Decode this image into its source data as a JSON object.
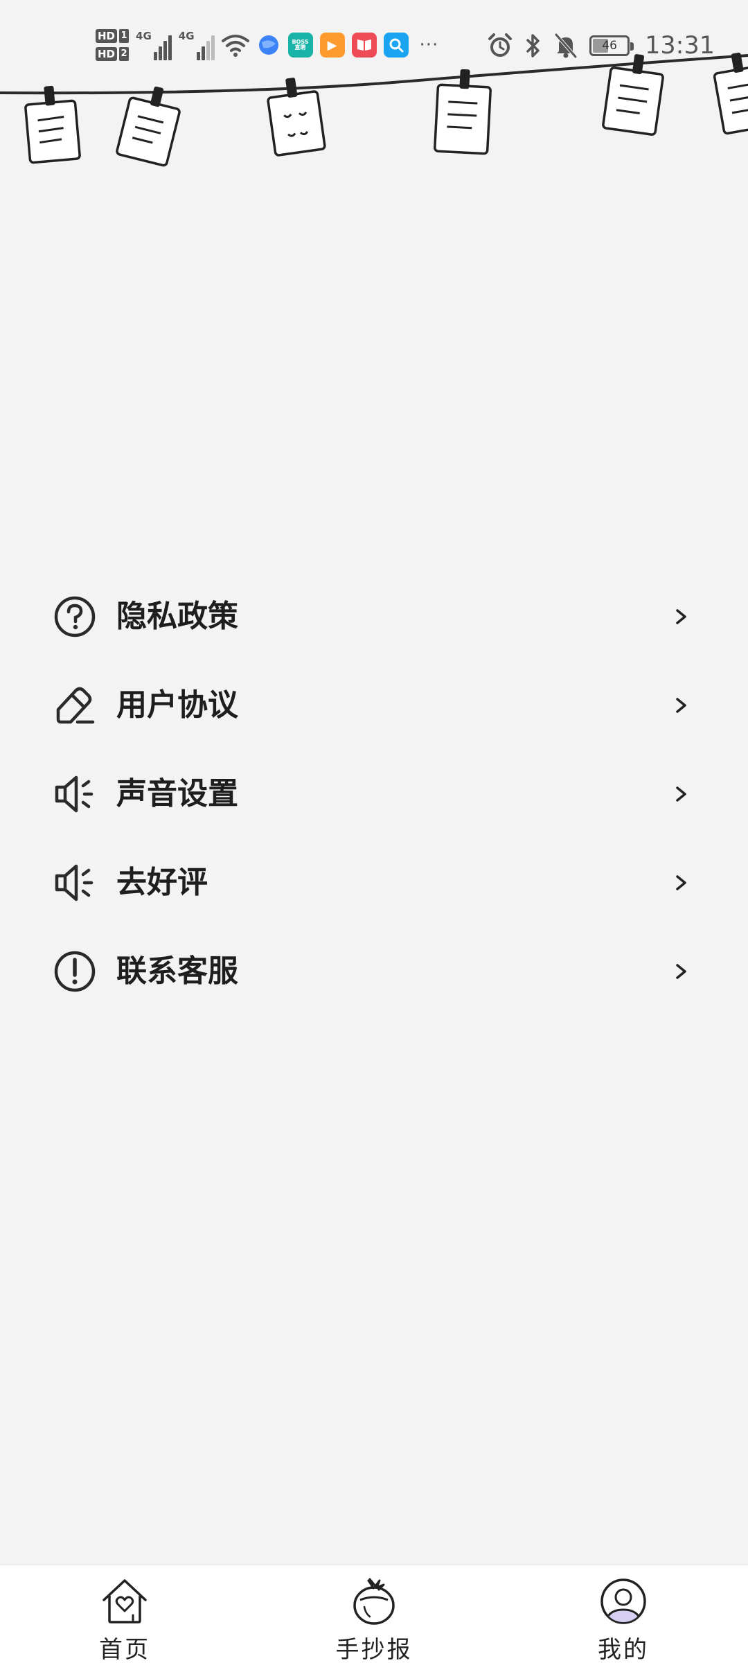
{
  "status_bar": {
    "sim_badges": [
      {
        "hd": "HD",
        "slot": "1"
      },
      {
        "hd": "HD",
        "slot": "2"
      }
    ],
    "network_type_1": "4G",
    "network_type_2": "4G",
    "app_icons": [
      {
        "name": "browser-icon",
        "color": "#3b82f6",
        "text": ""
      },
      {
        "name": "boss-zhipin-icon",
        "color": "#18b3a6",
        "text": "BOSS直聘"
      },
      {
        "name": "video-app-icon",
        "color": "#ff9a2e",
        "text": "▶"
      },
      {
        "name": "reader-app-icon",
        "color": "#ee4b57",
        "text": ""
      },
      {
        "name": "search-app-icon",
        "color": "#1aa3f0",
        "text": ""
      }
    ],
    "overflow": "···",
    "battery_level": "46",
    "battery_fraction": 0.46,
    "time": "13:31"
  },
  "menu": {
    "items": [
      {
        "id": "privacy",
        "label": "隐私政策",
        "icon": "question-circle-icon"
      },
      {
        "id": "agreement",
        "label": "用户协议",
        "icon": "pencil-icon"
      },
      {
        "id": "sound",
        "label": "声音设置",
        "icon": "speaker-icon"
      },
      {
        "id": "review",
        "label": "去好评",
        "icon": "speaker-icon"
      },
      {
        "id": "support",
        "label": "联系客服",
        "icon": "exclamation-circle-icon"
      }
    ]
  },
  "tabbar": {
    "tabs": [
      {
        "id": "home",
        "label": "首页",
        "icon": "home-heart-icon"
      },
      {
        "id": "tabloid",
        "label": "手抄报",
        "icon": "tomato-icon"
      },
      {
        "id": "mine",
        "label": "我的",
        "icon": "user-avatar-icon",
        "active": true
      }
    ]
  },
  "colors": {
    "background": "#f3f3f3",
    "tabbar_background": "#ffffff",
    "text": "#1e1e1e",
    "status_icons": "#555555"
  }
}
